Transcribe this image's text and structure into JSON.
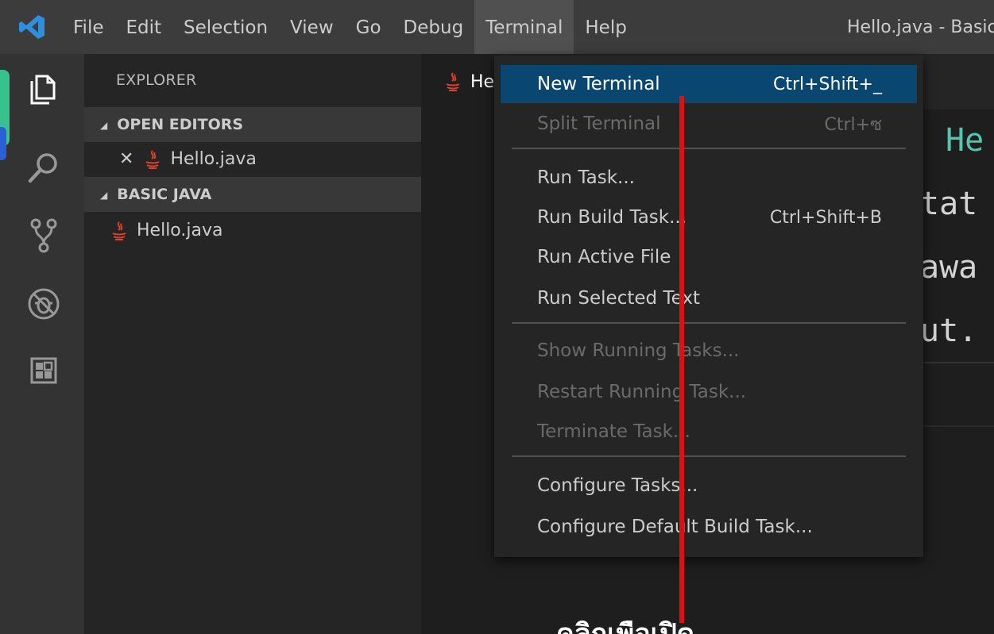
{
  "titlebar": {
    "menu": [
      {
        "label": "File",
        "active": false
      },
      {
        "label": "Edit",
        "active": false
      },
      {
        "label": "Selection",
        "active": false
      },
      {
        "label": "View",
        "active": false
      },
      {
        "label": "Go",
        "active": false
      },
      {
        "label": "Debug",
        "active": false
      },
      {
        "label": "Terminal",
        "active": true
      },
      {
        "label": "Help",
        "active": false
      }
    ],
    "window_title": "Hello.java - Basic"
  },
  "activitybar": {
    "icons": [
      "explorer-icon",
      "search-icon",
      "source-control-icon",
      "debug-icon",
      "extensions-icon"
    ]
  },
  "sidebar": {
    "title": "EXPLORER",
    "open_editors_header": "OPEN EDITORS",
    "open_editors": [
      {
        "name": "Hello.java"
      }
    ],
    "project_header": "BASIC JAVA",
    "project_files": [
      {
        "name": "Hello.java"
      }
    ]
  },
  "editor": {
    "tab_label": "He",
    "code_fragments": [
      "He",
      "tat",
      "awa",
      "ut."
    ]
  },
  "terminal_menu": {
    "groups": [
      [
        {
          "label": "New Terminal",
          "shortcut": "Ctrl+Shift+_",
          "state": "highlight"
        },
        {
          "label": "Split Terminal",
          "shortcut": "Ctrl+ซ",
          "state": "disabled"
        }
      ],
      [
        {
          "label": "Run Task...",
          "shortcut": "",
          "state": "normal"
        },
        {
          "label": "Run Build Task...",
          "shortcut": "Ctrl+Shift+B",
          "state": "normal"
        },
        {
          "label": "Run Active File",
          "shortcut": "",
          "state": "normal"
        },
        {
          "label": "Run Selected Text",
          "shortcut": "",
          "state": "normal"
        }
      ],
      [
        {
          "label": "Show Running Tasks...",
          "shortcut": "",
          "state": "disabled"
        },
        {
          "label": "Restart Running Task...",
          "shortcut": "",
          "state": "disabled"
        },
        {
          "label": "Terminate Task...",
          "shortcut": "",
          "state": "disabled"
        }
      ],
      [
        {
          "label": "Configure Tasks...",
          "shortcut": "",
          "state": "normal"
        },
        {
          "label": "Configure Default Build Task...",
          "shortcut": "",
          "state": "normal"
        }
      ]
    ]
  },
  "annotation": {
    "text": "คลิกเพื่อเปิด Terminal",
    "color": "#e01010"
  },
  "colors": {
    "menu_highlight": "#094771",
    "activity_accent": "#37c18c",
    "java_icon": "#d9412a"
  }
}
